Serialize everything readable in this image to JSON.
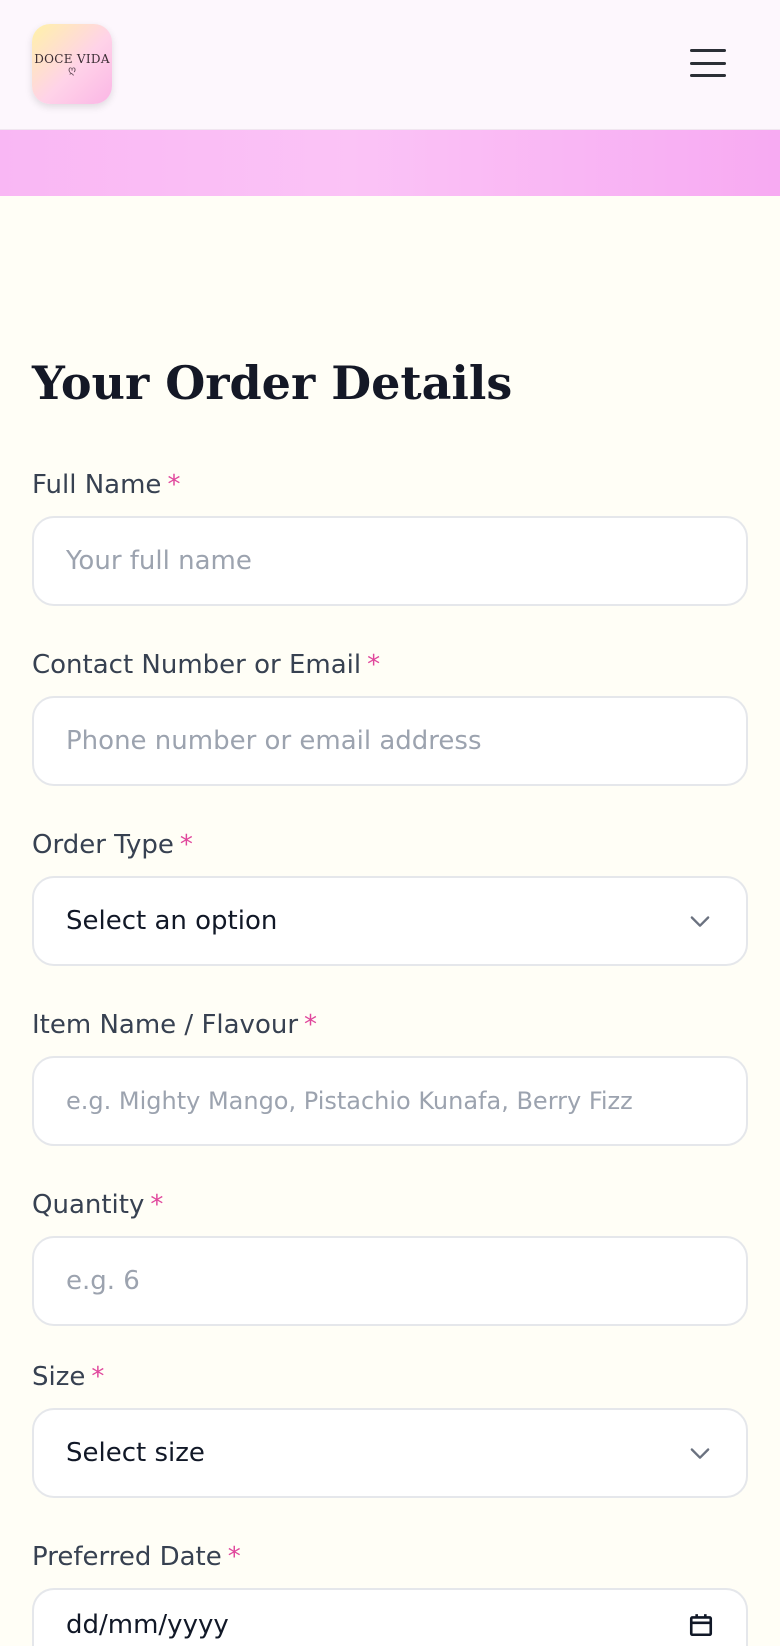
{
  "header": {
    "logo_text": "DOCE VIDA",
    "logo_swirl": "ღ",
    "menu_icon": "hamburger-menu-icon"
  },
  "form": {
    "title": "Your Order Details",
    "required_mark": "*",
    "full_name": {
      "label": "Full Name",
      "placeholder": "Your full name",
      "value": ""
    },
    "contact": {
      "label": "Contact Number or Email",
      "placeholder": "Phone number or email address",
      "value": ""
    },
    "order_type": {
      "label": "Order Type",
      "selected": "Select an option"
    },
    "item_name": {
      "label": "Item Name / Flavour",
      "placeholder": "e.g. Mighty Mango, Pistachio Kunafa, Berry Fizz",
      "value": ""
    },
    "quantity": {
      "label": "Quantity",
      "placeholder": "e.g. 6",
      "value": ""
    },
    "size": {
      "label": "Size",
      "selected": "Select size"
    },
    "preferred_date": {
      "label": "Preferred Date",
      "value": "dd/mm/yyyy"
    }
  },
  "colors": {
    "accent_pink": "#e0479c",
    "banner_pink": "#f9b7f4",
    "page_bg": "#fffef6"
  }
}
